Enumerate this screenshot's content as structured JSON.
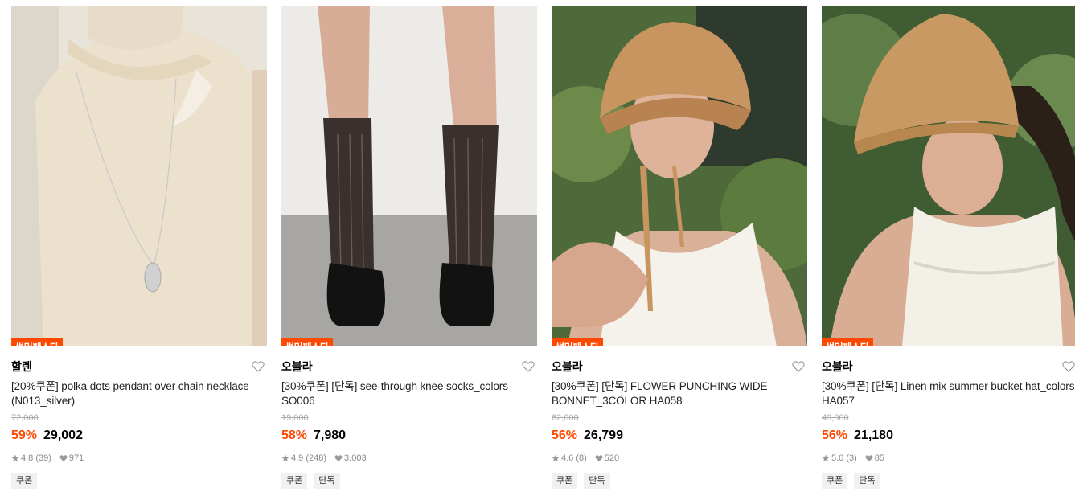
{
  "products": [
    {
      "badge": "썸머페스타",
      "brand": "할렌",
      "title": "[20%쿠폰] polka dots pendant over chain necklace (N013_silver)",
      "original_price": "72,000",
      "discount": "59%",
      "sale_price": "29,002",
      "rating": "4.8 (39)",
      "likes": "971",
      "tags": [
        "쿠폰"
      ]
    },
    {
      "badge": "썸머페스타",
      "brand": "오블라",
      "title": "[30%쿠폰] [단독] see-through knee socks_colors SO006",
      "original_price": "19,000",
      "discount": "58%",
      "sale_price": "7,980",
      "rating": "4.9 (248)",
      "likes": "3,003",
      "tags": [
        "쿠폰",
        "단독"
      ]
    },
    {
      "badge": "썸머페스타",
      "brand": "오블라",
      "title": "[30%쿠폰] [단독] FLOWER PUNCHING WIDE BONNET_3COLOR HA058",
      "original_price": "62,000",
      "discount": "56%",
      "sale_price": "26,799",
      "rating": "4.6 (8)",
      "likes": "520",
      "tags": [
        "쿠폰",
        "단독"
      ]
    },
    {
      "badge": "썸머페스타",
      "brand": "오블라",
      "title": "[30%쿠폰] [단독] Linen mix summer bucket hat_colors HA057",
      "original_price": "49,000",
      "discount": "56%",
      "sale_price": "21,180",
      "rating": "5.0 (3)",
      "likes": "85",
      "tags": [
        "쿠폰",
        "단독"
      ]
    }
  ],
  "colors": {
    "accent": "#ff4800",
    "price": "#000000",
    "muted": "#888888"
  }
}
